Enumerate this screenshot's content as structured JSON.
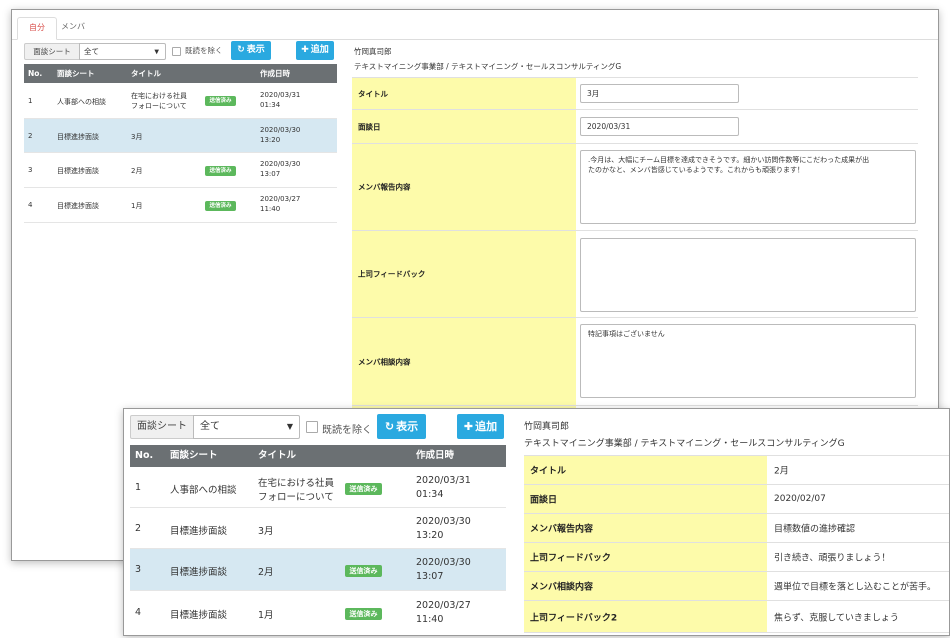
{
  "back": {
    "tabs": [
      {
        "label": "自分"
      },
      {
        "label": "メンバ"
      }
    ],
    "toolbar": {
      "sheet_label": "面談シート",
      "sheet_value": "全て",
      "exclude_read_label": "既読を除く",
      "show_label": "表示",
      "add_label": "追加"
    },
    "table": {
      "headers": [
        "No.",
        "面談シート",
        "タイトル",
        "作成日時"
      ],
      "rows": [
        {
          "no": "1",
          "sheet": "人事部への相談",
          "title1": "在宅における社員",
          "title2": "フォローについて",
          "badge": "送信済み",
          "date": "2020/03/31",
          "time": "01:34"
        },
        {
          "no": "2",
          "sheet": "目標進捗面談",
          "title1": "3月",
          "title2": "",
          "badge": "",
          "date": "2020/03/30",
          "time": "13:20"
        },
        {
          "no": "3",
          "sheet": "目標進捗面談",
          "title1": "2月",
          "title2": "",
          "badge": "送信済み",
          "date": "2020/03/30",
          "time": "13:07"
        },
        {
          "no": "4",
          "sheet": "目標進捗面談",
          "title1": "1月",
          "title2": "",
          "badge": "送信済み",
          "date": "2020/03/27",
          "time": "11:40"
        }
      ]
    },
    "detail": {
      "person_name": "竹岡真司郎",
      "department": "テキストマイニング事業部 / テキストマイニング・セールスコンサルティングG",
      "fields": [
        {
          "label": "タイトル",
          "value": "3月"
        },
        {
          "label": "面談日",
          "value": "2020/03/31"
        },
        {
          "label": "メンバ報告内容",
          "line1": ".今月は、大幅にチーム目標を達成できそうです。細かい訪問件数等にこだわった成果が出",
          "line2": "たのかなと、メンバ皆感じているようです。これからも頑張ります！"
        },
        {
          "label": "上司フィードバック",
          "value": ""
        },
        {
          "label": "メンバ相談内容",
          "value": "特記事項はございません"
        }
      ]
    }
  },
  "front": {
    "toolbar": {
      "sheet_label": "面談シート",
      "sheet_value": "全て",
      "exclude_read_label": "既読を除く",
      "show_label": "表示",
      "add_label": "追加"
    },
    "table": {
      "headers": [
        "No.",
        "面談シート",
        "タイトル",
        "作成日時"
      ],
      "rows": [
        {
          "no": "1",
          "sheet": "人事部への相談",
          "title1": "在宅における社員",
          "title2": "フォローについて",
          "badge": "送信済み",
          "date": "2020/03/31",
          "time": "01:34"
        },
        {
          "no": "2",
          "sheet": "目標進捗面談",
          "title1": "3月",
          "title2": "",
          "badge": "",
          "date": "2020/03/30",
          "time": "13:20"
        },
        {
          "no": "3",
          "sheet": "目標進捗面談",
          "title1": "2月",
          "title2": "",
          "badge": "送信済み",
          "date": "2020/03/30",
          "time": "13:07"
        },
        {
          "no": "4",
          "sheet": "目標進捗面談",
          "title1": "1月",
          "title2": "",
          "badge": "送信済み",
          "date": "2020/03/27",
          "time": "11:40"
        }
      ]
    },
    "detail": {
      "person_name": "竹岡真司郎",
      "department": "テキストマイニング事業部 / テキストマイニング・セールスコンサルティングG",
      "fields": [
        {
          "label": "タイトル",
          "value": "2月"
        },
        {
          "label": "面談日",
          "value": "2020/02/07"
        },
        {
          "label": "メンバ報告内容",
          "value": "目標数値の進捗確認"
        },
        {
          "label": "上司フィードバック",
          "value": "引き続き、頑張りましょう！"
        },
        {
          "label": "メンバ相談内容",
          "value": "週単位で目標を落とし込むことが苦手。"
        },
        {
          "label": "上司フィードバック2",
          "value": "焦らず、克服していきましょう"
        }
      ]
    }
  },
  "colors": {
    "accent": "#2aa9e0",
    "header_bg": "#6b7073",
    "selected_row": "#d6e8f2",
    "badge": "#5cb85c",
    "key_cell": "#fdfbaa",
    "active_tab": "#d9534f"
  },
  "icons": {
    "refresh": "refresh-icon",
    "plus": "plus-icon",
    "caret": "caret-down-icon"
  }
}
